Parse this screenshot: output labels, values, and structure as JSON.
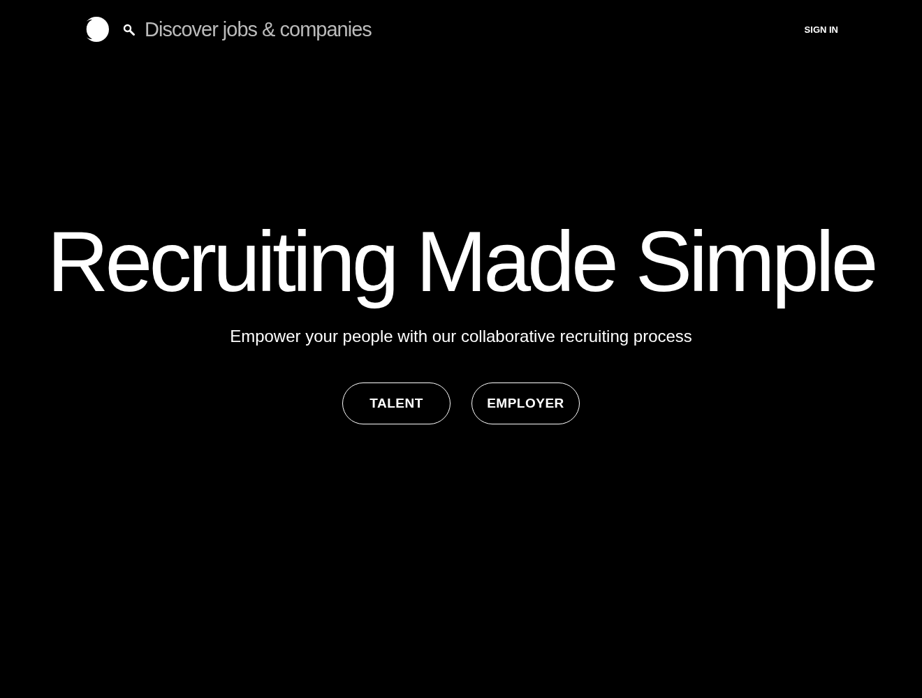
{
  "header": {
    "search": {
      "placeholder": "Discover jobs & companies"
    },
    "sign_in": "SIGN IN"
  },
  "hero": {
    "title": "Recruiting Made Simple",
    "subtitle": "Empower your people with our collaborative recruiting process",
    "buttons": [
      "TALENT",
      "EMPLOYER"
    ]
  }
}
